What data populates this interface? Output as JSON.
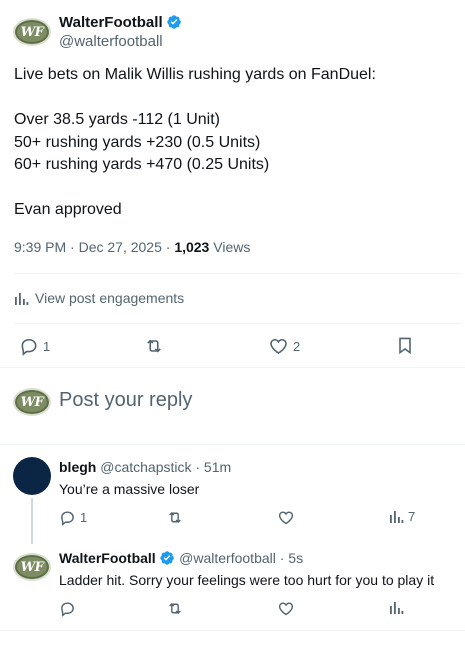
{
  "main_post": {
    "author_name": "WalterFootball",
    "handle": "@walterfootball",
    "avatar_text": "WF",
    "text": "Live bets on Malik Willis rushing yards on FanDuel:\n\nOver 38.5 yards -112 (1 Unit)\n50+ rushing yards +230 (0.5 Units)\n60+ rushing yards +470 (0.25 Units)\n\nEvan approved",
    "time": "9:39 PM · Dec 27, 2025 · ",
    "views_count": "1,023",
    "views_label": " Views",
    "engagements_label": "View post engagements",
    "replies": "1",
    "likes": "2"
  },
  "compose": {
    "avatar_text": "WF",
    "placeholder": "Post your reply"
  },
  "replies": [
    {
      "author_name": "blegh",
      "handle": "@catchapstick",
      "time": " · 51m",
      "text": "You’re a massive loser",
      "replies": "1",
      "views": "7"
    },
    {
      "author_name": "WalterFootball",
      "handle": "@walterfootball",
      "time": " · 5s",
      "avatar_text": "WF",
      "text": "Ladder hit. Sorry your feelings were too hurt for you to play it"
    }
  ],
  "colors": {
    "verified": "#1d9bf0",
    "secondary_text": "#536471",
    "divider": "#eff3f4",
    "blegh_avatar": "#0b2545"
  }
}
